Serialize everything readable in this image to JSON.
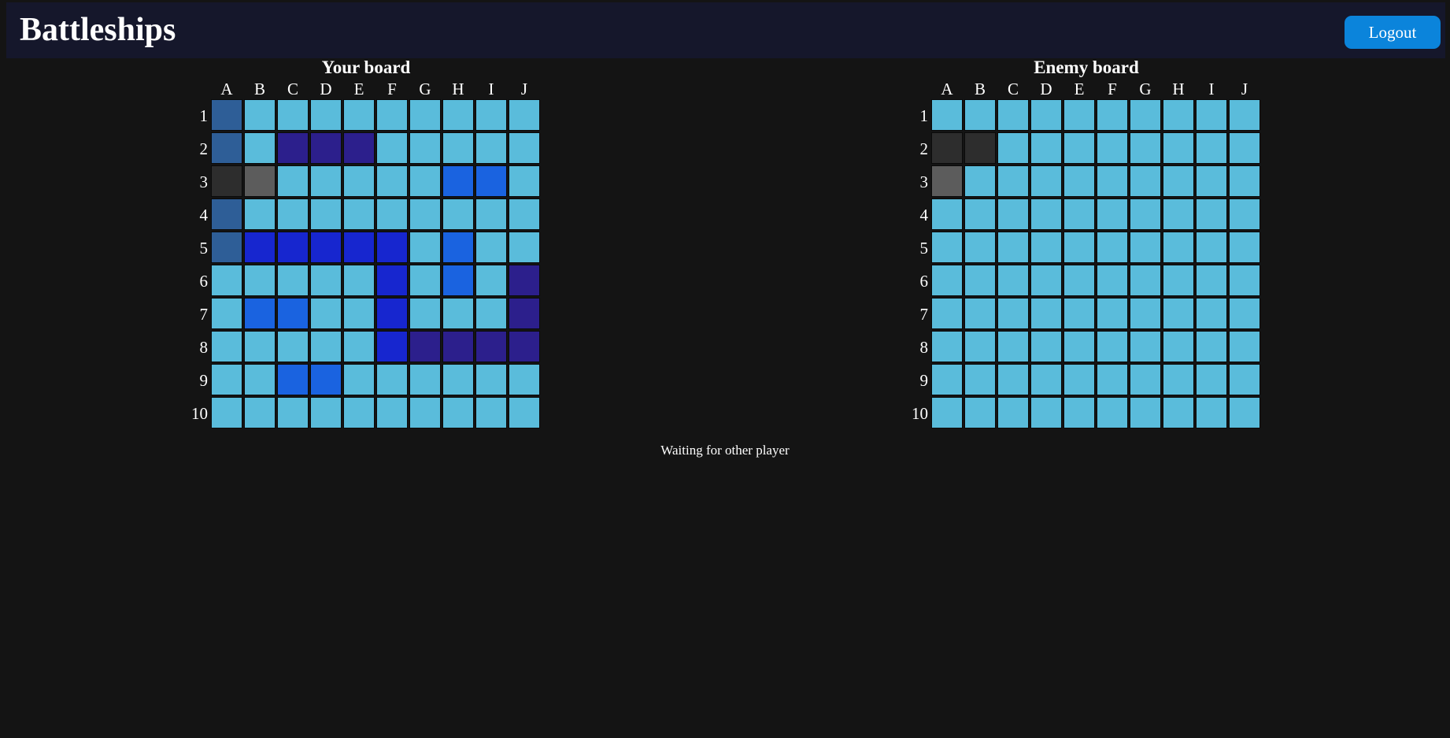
{
  "header": {
    "title": "Battleships",
    "logout_label": "Logout"
  },
  "columns": [
    "A",
    "B",
    "C",
    "D",
    "E",
    "F",
    "G",
    "H",
    "I",
    "J"
  ],
  "rows": [
    "1",
    "2",
    "3",
    "4",
    "5",
    "6",
    "7",
    "8",
    "9",
    "10"
  ],
  "colors": {
    "water": "#5abcdb",
    "ship_steel": "#2e5e97",
    "ship_indigo": "#2c1f8c",
    "ship_blue": "#1a63e0",
    "ship_royal": "#1726cf",
    "miss": "#2d2d2d",
    "hit": "#5c5c5c",
    "accent": "#0b84db"
  },
  "your_board": {
    "title": "Your board",
    "cells": {
      "A1": "ship_steel",
      "A2": "ship_steel",
      "C2": "ship_indigo",
      "D2": "ship_indigo",
      "E2": "ship_indigo",
      "A3": "miss",
      "B3": "hit",
      "H3": "ship_blue",
      "I3": "ship_blue",
      "A4": "ship_steel",
      "A5": "ship_steel",
      "B5": "ship_royal",
      "C5": "ship_royal",
      "D5": "ship_royal",
      "E5": "ship_royal",
      "F5": "ship_royal",
      "H5": "ship_blue",
      "F6": "ship_royal",
      "H6": "ship_blue",
      "J6": "ship_indigo",
      "B7": "ship_blue",
      "C7": "ship_blue",
      "F7": "ship_royal",
      "J7": "ship_indigo",
      "F8": "ship_royal",
      "G8": "ship_indigo",
      "H8": "ship_indigo",
      "I8": "ship_indigo",
      "J8": "ship_indigo",
      "C9": "ship_blue",
      "D9": "ship_blue"
    }
  },
  "enemy_board": {
    "title": "Enemy board",
    "cells": {
      "A2": "miss",
      "B2": "miss",
      "A3": "hit"
    }
  },
  "status": "Waiting for other player"
}
